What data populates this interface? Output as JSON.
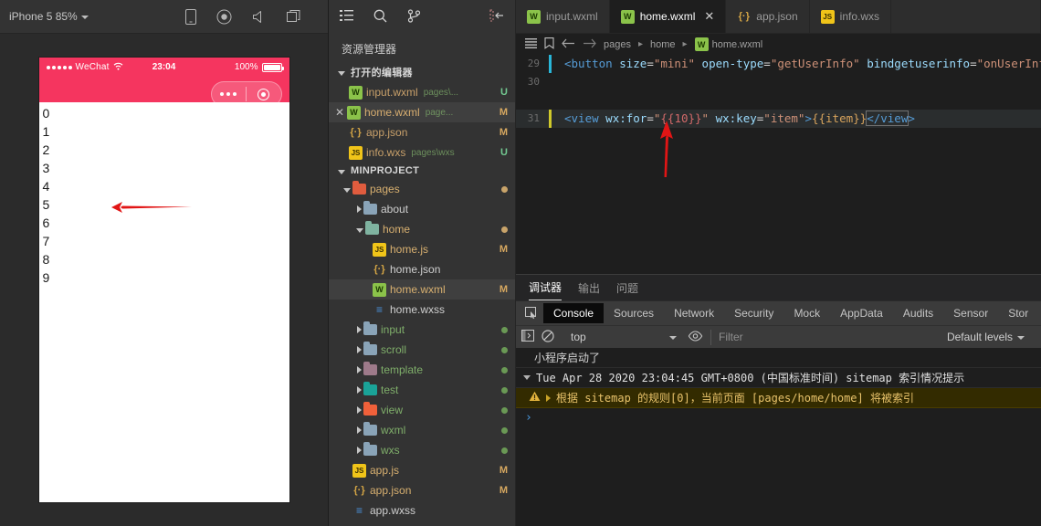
{
  "simulator": {
    "device_label": "iPhone 5 85%",
    "toolbar_icons": [
      "phone-icon",
      "record-icon",
      "sound-icon",
      "copy-icon"
    ],
    "phone": {
      "carrier": "WeChat",
      "time": "23:04",
      "battery_percent": "100%",
      "list_items": [
        "0",
        "1",
        "2",
        "3",
        "4",
        "5",
        "6",
        "7",
        "8",
        "9"
      ],
      "header_color": "#f5355f"
    },
    "annotation": "red-left-arrow"
  },
  "explorer": {
    "activity_icons": [
      "explorer-icon",
      "search-icon",
      "source-control-icon",
      "collapse-icon"
    ],
    "title": "资源管理器",
    "open_editors": {
      "label": "打开的编辑器",
      "files": [
        {
          "name": "input.wxml",
          "path": "pages\\...",
          "status": "U",
          "icon": "wxml-icon",
          "active": false,
          "closable": false
        },
        {
          "name": "home.wxml",
          "path": "page...",
          "status": "M",
          "icon": "wxml-icon",
          "active": true,
          "closable": true
        },
        {
          "name": "app.json",
          "path": "",
          "status": "M",
          "icon": "json-icon",
          "active": false,
          "closable": false
        },
        {
          "name": "info.wxs",
          "path": "pages\\wxs",
          "status": "U",
          "icon": "js-icon",
          "active": false,
          "closable": false
        }
      ]
    },
    "project": {
      "label": "MINPROJECT",
      "items": [
        {
          "name": "pages",
          "type": "folder",
          "depth": 1,
          "expanded": true,
          "color": "#e05c3e",
          "dot": "#c9a46a"
        },
        {
          "name": "about",
          "type": "folder",
          "depth": 2,
          "expanded": false,
          "color": "#8aa4b8",
          "dot": ""
        },
        {
          "name": "home",
          "type": "folder",
          "depth": 2,
          "expanded": true,
          "color": "#7fb3a0",
          "dot": "#c9a46a"
        },
        {
          "name": "home.js",
          "type": "js",
          "depth": 3,
          "status": "M"
        },
        {
          "name": "home.json",
          "type": "json",
          "depth": 3,
          "status": ""
        },
        {
          "name": "home.wxml",
          "type": "wxml",
          "depth": 3,
          "status": "M",
          "active": true
        },
        {
          "name": "home.wxss",
          "type": "wxss",
          "depth": 3,
          "status": ""
        },
        {
          "name": "input",
          "type": "folder",
          "depth": 2,
          "expanded": false,
          "color": "#8aa4b8",
          "dot": "#6a9955",
          "green": true
        },
        {
          "name": "scroll",
          "type": "folder",
          "depth": 2,
          "expanded": false,
          "color": "#8aa4b8",
          "dot": "#6a9955",
          "green": true
        },
        {
          "name": "template",
          "type": "folder",
          "depth": 2,
          "expanded": false,
          "color": "#9e7a8a",
          "dot": "#6a9955",
          "green": true
        },
        {
          "name": "test",
          "type": "folder",
          "depth": 2,
          "expanded": false,
          "color": "#1aa398",
          "dot": "#6a9955",
          "green": true
        },
        {
          "name": "view",
          "type": "folder",
          "depth": 2,
          "expanded": false,
          "color": "#f0603a",
          "dot": "#6a9955",
          "green": true
        },
        {
          "name": "wxml",
          "type": "folder",
          "depth": 2,
          "expanded": false,
          "color": "#8aa4b8",
          "dot": "#6a9955",
          "green": true
        },
        {
          "name": "wxs",
          "type": "folder",
          "depth": 2,
          "expanded": false,
          "color": "#8aa4b8",
          "dot": "#6a9955",
          "green": true
        },
        {
          "name": "app.js",
          "type": "js",
          "depth": 2,
          "status": "M"
        },
        {
          "name": "app.json",
          "type": "json",
          "depth": 2,
          "status": "M"
        },
        {
          "name": "app.wxss",
          "type": "wxss",
          "depth": 2,
          "status": ""
        }
      ]
    }
  },
  "editor": {
    "tabs": [
      {
        "label": "input.wxml",
        "icon": "wxml-icon",
        "active": false,
        "closable": false
      },
      {
        "label": "home.wxml",
        "icon": "wxml-icon",
        "active": true,
        "closable": true
      },
      {
        "label": "app.json",
        "icon": "json-icon",
        "active": false,
        "closable": false
      },
      {
        "label": "info.wxs",
        "icon": "js-icon",
        "active": false,
        "closable": false
      }
    ],
    "toolbar_icons": [
      "outline-icon",
      "bookmark-icon",
      "back-arrow-icon",
      "forward-arrow-icon"
    ],
    "breadcrumb": [
      "pages",
      "home",
      "home.wxml"
    ],
    "lines": [
      {
        "number": "29",
        "marker": "cyan"
      },
      {
        "number": "30",
        "marker": "none"
      },
      {
        "number": "31",
        "marker": "yellow"
      }
    ],
    "line29_code": "<button size=\"mini\" open-type=\"getUserInfo\" bindgetuserinfo=\"onUserInfo\">获取用",
    "line31_code": "<view wx:for=\"{{10}}\" wx:key=\"item\">{{item}}</view>",
    "annotation": "red-up-arrow"
  },
  "debugger": {
    "panel_tabs": [
      {
        "label": "调试器",
        "active": true
      },
      {
        "label": "输出",
        "active": false
      },
      {
        "label": "问题",
        "active": false
      }
    ],
    "devtools_tabs": [
      {
        "label": "Console",
        "active": true
      },
      {
        "label": "Sources",
        "active": false
      },
      {
        "label": "Network",
        "active": false
      },
      {
        "label": "Security",
        "active": false
      },
      {
        "label": "Mock",
        "active": false
      },
      {
        "label": "AppData",
        "active": false
      },
      {
        "label": "Audits",
        "active": false
      },
      {
        "label": "Sensor",
        "active": false
      },
      {
        "label": "Stor",
        "active": false
      }
    ],
    "console_bar": {
      "context": "top",
      "filter_placeholder": "Filter",
      "levels": "Default levels"
    },
    "messages": [
      {
        "type": "plain",
        "text": "小程序启动了"
      },
      {
        "type": "group",
        "text": "Tue Apr 28 2020 23:04:45 GMT+0800 (中国标准时间) sitemap 索引情况提示"
      },
      {
        "type": "warn",
        "text": "根据 sitemap 的规则[0]，当前页面 [pages/home/home] 将被索引"
      }
    ],
    "prompt": "›"
  }
}
